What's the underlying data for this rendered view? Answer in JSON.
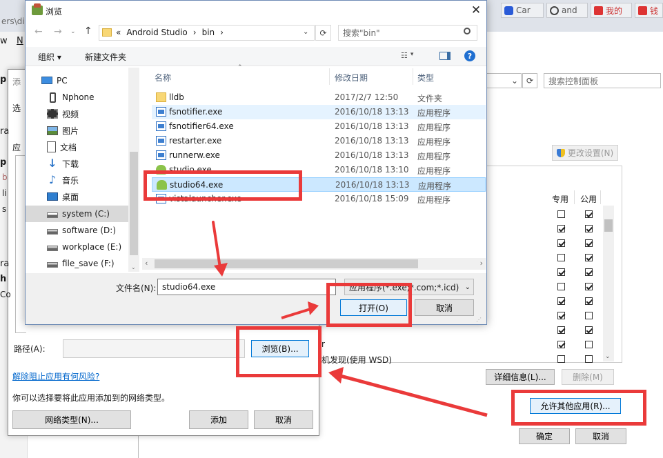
{
  "bg": {
    "top_path": "ers\\dill",
    "tabs": [
      {
        "label": "Car"
      },
      {
        "label": "and"
      },
      {
        "label": "我的"
      },
      {
        "label": "钱"
      }
    ],
    "left_menu_w": "w",
    "left_menu_n": "N",
    "cp_search_placeholder": "搜索控制面板",
    "change_settings": "更改设置(N)",
    "col_private": "专用",
    "col_public": "公用",
    "row_text_r": "r",
    "row_text_wsd": "机发现(使用 WSD)",
    "details_btn": "详细信息(L)...",
    "delete_btn": "删除(M)",
    "allow_btn": "允许其他应用(R)...",
    "ok_btn": "确定",
    "cancel_btn": "取消",
    "left_letters": [
      "添",
      "选",
      "应"
    ],
    "left_edge": [
      "p",
      "ra",
      "p",
      "b",
      "li",
      "s",
      "ra",
      "h",
      "Co"
    ]
  },
  "addapp": {
    "path_label": "路径(A):",
    "browse_btn": "浏览(B)...",
    "risk_link": "解除阻止应用有何风险?",
    "hint": "你可以选择要将此应用添加到的网络类型。",
    "nettype_btn": "网络类型(N)...",
    "add_btn": "添加",
    "cancel_btn": "取消"
  },
  "browse": {
    "title": "浏览",
    "breadcrumb": [
      "«",
      "Android Studio",
      "›",
      "bin",
      "›"
    ],
    "search_placeholder": "搜索\"bin\"",
    "organize": "组织 ▾",
    "new_folder": "新建文件夹",
    "nav": [
      {
        "label": "PC"
      },
      {
        "label": "Nphone"
      },
      {
        "label": "视频"
      },
      {
        "label": "图片"
      },
      {
        "label": "文档"
      },
      {
        "label": "下载"
      },
      {
        "label": "音乐"
      },
      {
        "label": "桌面"
      },
      {
        "label": "system (C:)"
      },
      {
        "label": "software (D:)"
      },
      {
        "label": "workplace (E:)"
      },
      {
        "label": "file_save (F:)"
      }
    ],
    "columns": {
      "name": "名称",
      "date": "修改日期",
      "type": "类型"
    },
    "files": [
      {
        "name": "lldb",
        "date": "2017/2/7 12:50",
        "type": "文件夹"
      },
      {
        "name": "fsnotifier.exe",
        "date": "2016/10/18 13:13",
        "type": "应用程序"
      },
      {
        "name": "fsnotifier64.exe",
        "date": "2016/10/18 13:13",
        "type": "应用程序"
      },
      {
        "name": "restarter.exe",
        "date": "2016/10/18 13:13",
        "type": "应用程序"
      },
      {
        "name": "runnerw.exe",
        "date": "2016/10/18 13:13",
        "type": "应用程序"
      },
      {
        "name": "studio.exe",
        "date": "2016/10/18 13:10",
        "type": "应用程序"
      },
      {
        "name": "studio64.exe",
        "date": "2016/10/18 13:13",
        "type": "应用程序"
      },
      {
        "name": "vistalauncher.exe",
        "date": "2016/10/18 15:09",
        "type": "应用程序"
      }
    ],
    "filename_label": "文件名(N):",
    "filename_value": "studio64.exe",
    "filter_value": "应用程序(*.exe;*.com;*.icd)",
    "open_btn": "打开(O)",
    "cancel_btn": "取消"
  },
  "colors": {
    "accent": "#0078d7",
    "annotation_red": "#ea3a3a",
    "selection": "#cce8ff",
    "link": "#0066cc"
  }
}
